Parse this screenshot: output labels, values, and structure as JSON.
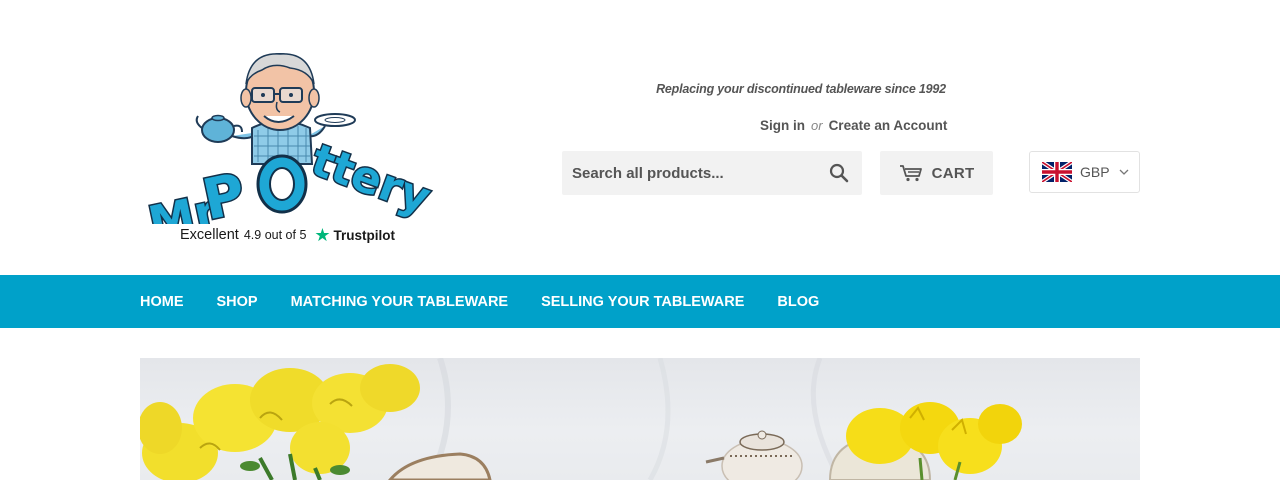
{
  "header": {
    "logo_text": "MrPottery",
    "trustpilot": {
      "rating_word": "Excellent",
      "score_text": "4.9 out of 5",
      "brand": "Trustpilot"
    },
    "tagline": "Replacing your discontinued tableware since 1992",
    "account": {
      "sign_in": "Sign in",
      "or": "or",
      "create_account": "Create an Account"
    },
    "search": {
      "placeholder": "Search all products..."
    },
    "cart": {
      "label": "CART"
    },
    "currency": {
      "code": "GBP"
    }
  },
  "nav": {
    "items": [
      {
        "label": "HOME"
      },
      {
        "label": "SHOP"
      },
      {
        "label": "MATCHING YOUR TABLEWARE"
      },
      {
        "label": "SELLING YOUR TABLEWARE"
      },
      {
        "label": "BLOG"
      }
    ]
  },
  "colors": {
    "nav_background": "#00a1c9",
    "logo_blue": "#1ea7d5",
    "trustpilot_green": "#00b67a"
  }
}
